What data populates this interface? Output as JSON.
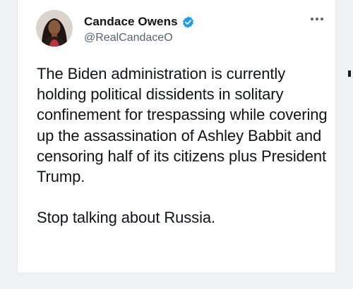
{
  "tweet": {
    "author": {
      "display_name": "Candace Owens",
      "handle": "@RealCandaceO",
      "verified": true,
      "avatar_icon": "profile-photo"
    },
    "more_icon": "ellipsis-icon",
    "paragraphs": [
      "The Biden administration is currently holding political dissidents in solitary confinement for trespassing while covering up the assassination of Ashley Babbit and censoring half of its citizens plus President Trump.",
      "Stop talking about Russia."
    ]
  },
  "colors": {
    "text_primary": "#0f1419",
    "text_secondary": "#536471",
    "verified_blue": "#1d9bf0",
    "page_background": "#eff1f4",
    "card_background": "#ffffff"
  }
}
